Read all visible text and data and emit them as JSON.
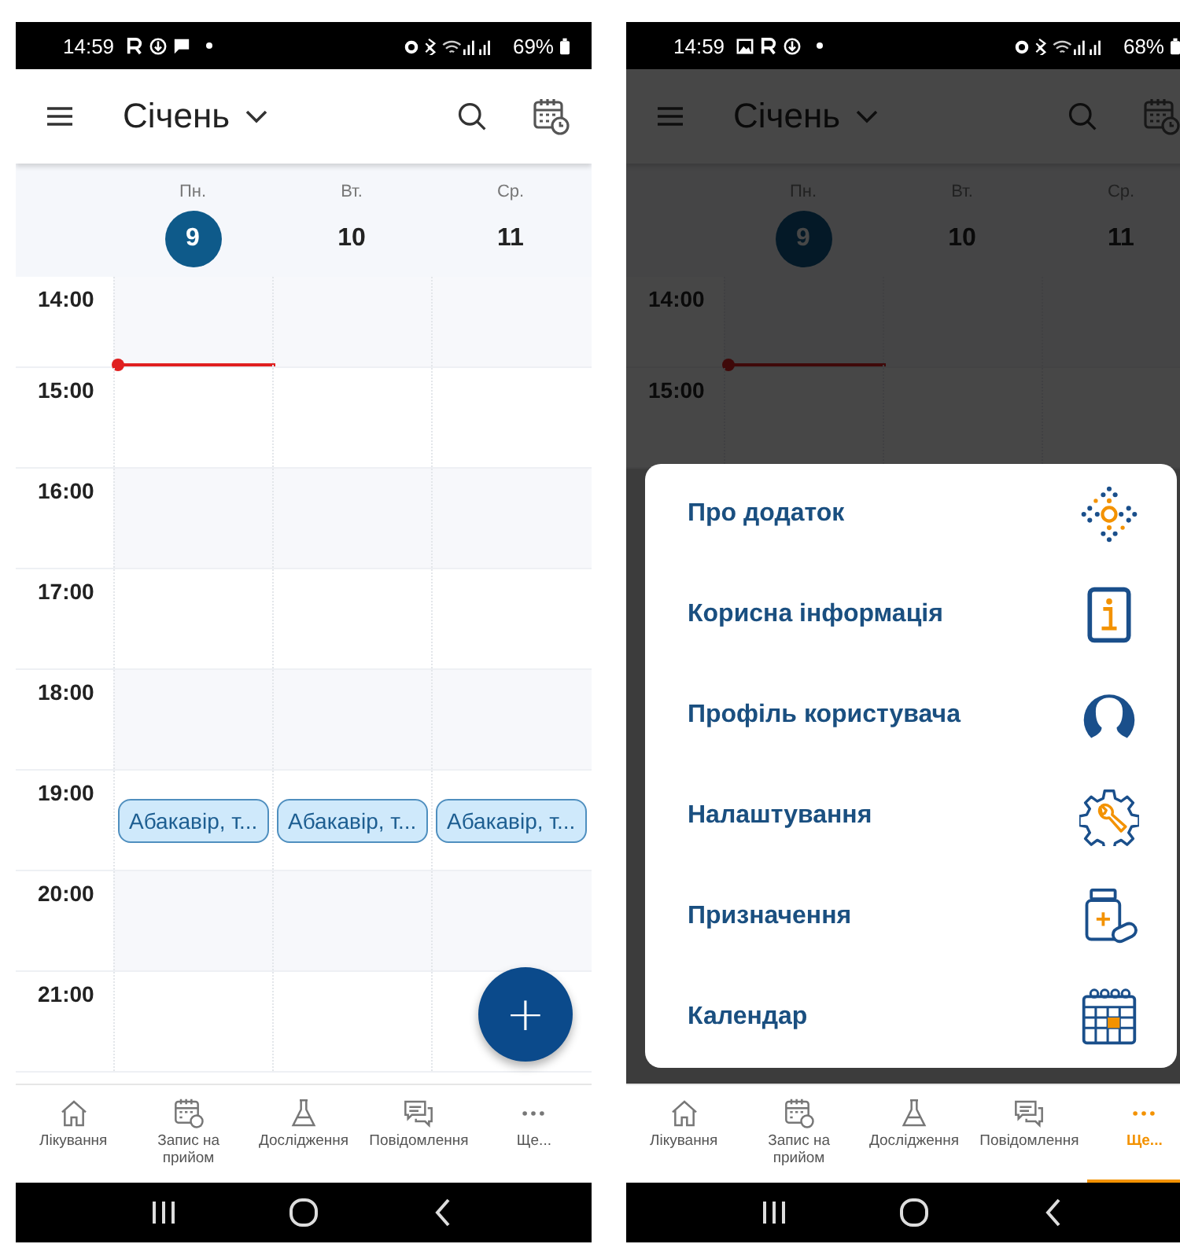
{
  "screens": [
    {
      "status_bar": {
        "time": "14:59",
        "icons": [
          {
            "kind": "letter-r"
          },
          {
            "kind": "ring"
          },
          {
            "kind": "message"
          },
          {
            "kind": "dot"
          }
        ],
        "battery": "69%"
      },
      "header": {
        "title": "Січень"
      },
      "dimmed": false,
      "days": [
        {
          "weekday": "Пн.",
          "date": "9",
          "selected": true
        },
        {
          "weekday": "Вт.",
          "date": "10",
          "selected": false
        },
        {
          "weekday": "Ср.",
          "date": "11",
          "selected": false
        }
      ],
      "hours": [
        {
          "label": "14:00"
        },
        {
          "label": "15:00"
        },
        {
          "label": "16:00"
        },
        {
          "label": "17:00"
        },
        {
          "label": "18:00"
        },
        {
          "label": "19:00",
          "events": [
            "Абакавір, т...",
            "Абакавір, т...",
            "Абакавір, т..."
          ]
        },
        {
          "label": "20:00"
        },
        {
          "label": "21:00"
        }
      ],
      "fab": {
        "label": "+"
      },
      "nav": [
        {
          "kind": "home",
          "label": "Лікування",
          "selected": false
        },
        {
          "kind": "appointment",
          "label": "Запис на прийом",
          "selected": false
        },
        {
          "kind": "research",
          "label": "Дослідження",
          "selected": false
        },
        {
          "kind": "messages",
          "label": "Повідомлення",
          "selected": false
        },
        {
          "kind": "more",
          "label": "Ще...",
          "selected": false
        }
      ]
    },
    {
      "status_bar": {
        "time": "14:59",
        "icons": [
          {
            "kind": "image"
          },
          {
            "kind": "letter-r"
          },
          {
            "kind": "ring"
          },
          {
            "kind": "dot"
          }
        ],
        "battery": "68%"
      },
      "header": {
        "title": "Січень"
      },
      "dimmed": true,
      "days": [
        {
          "weekday": "Пн.",
          "date": "9",
          "selected": true
        },
        {
          "weekday": "Вт.",
          "date": "10",
          "selected": false
        },
        {
          "weekday": "Ср.",
          "date": "11",
          "selected": false
        }
      ],
      "hours": [
        {
          "label": "14:00"
        },
        {
          "label": "15:00"
        }
      ],
      "menu": [
        {
          "kind": "about",
          "label": "Про додаток"
        },
        {
          "kind": "info",
          "label": "Корисна інформація"
        },
        {
          "kind": "profile",
          "label": "Профіль користувача"
        },
        {
          "kind": "settings",
          "label": "Налаштування"
        },
        {
          "kind": "prescriptions",
          "label": "Призначення"
        },
        {
          "kind": "calendar",
          "label": "Календар"
        }
      ],
      "nav": [
        {
          "kind": "home",
          "label": "Лікування",
          "selected": false
        },
        {
          "kind": "appointment",
          "label": "Запис на прийом",
          "selected": false
        },
        {
          "kind": "research",
          "label": "Дослідження",
          "selected": false
        },
        {
          "kind": "messages",
          "label": "Повідомлення",
          "selected": false
        },
        {
          "kind": "more",
          "label": "Ще...",
          "selected": true
        }
      ]
    }
  ]
}
